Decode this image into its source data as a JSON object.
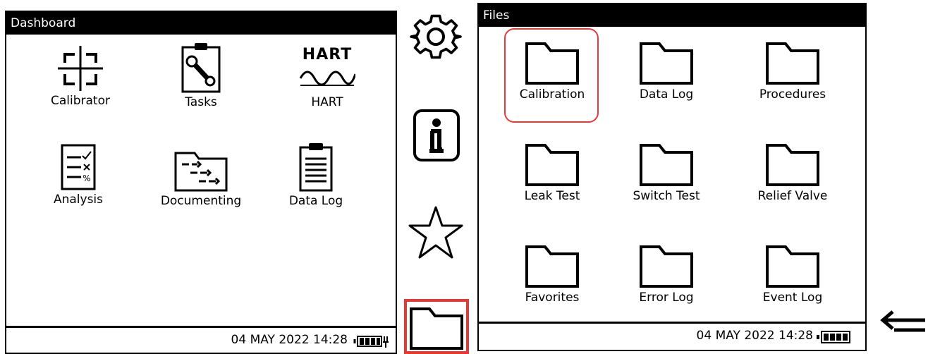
{
  "dashboard": {
    "title": "Dashboard",
    "tiles": [
      {
        "label": "Calibrator",
        "icon": "crosshair-calibrator-icon"
      },
      {
        "label": "Tasks",
        "icon": "clipboard-wrench-icon"
      },
      {
        "label": "HART",
        "icon": "hart-icon",
        "icon_text": "HART"
      },
      {
        "label": "Analysis",
        "icon": "analysis-document-icon"
      },
      {
        "label": "Documenting",
        "icon": "documenting-folder-icon"
      },
      {
        "label": "Data Log",
        "icon": "clipboard-list-icon"
      }
    ],
    "status": {
      "datetime": "04 MAY 2022 14:28",
      "battery_icon": "battery-charging-icon"
    }
  },
  "sidebar": {
    "items": [
      {
        "name": "settings",
        "icon": "gear-icon"
      },
      {
        "name": "information",
        "icon": "info-icon"
      },
      {
        "name": "favorites",
        "icon": "star-icon"
      },
      {
        "name": "files",
        "icon": "folder-icon",
        "highlighted": true
      }
    ],
    "highlight_color": "#e53935"
  },
  "files": {
    "title": "Files",
    "folders": [
      {
        "label": "Calibration",
        "selected": true
      },
      {
        "label": "Data Log"
      },
      {
        "label": "Procedures"
      },
      {
        "label": "Leak Test"
      },
      {
        "label": "Switch Test"
      },
      {
        "label": "Relief Valve"
      },
      {
        "label": "Favorites"
      },
      {
        "label": "Error Log"
      },
      {
        "label": "Event Log"
      }
    ],
    "status": {
      "datetime": "04 MAY 2022 14:28",
      "battery_icon": "battery-icon"
    }
  },
  "back_arrow_icon": "back-arrow-icon"
}
